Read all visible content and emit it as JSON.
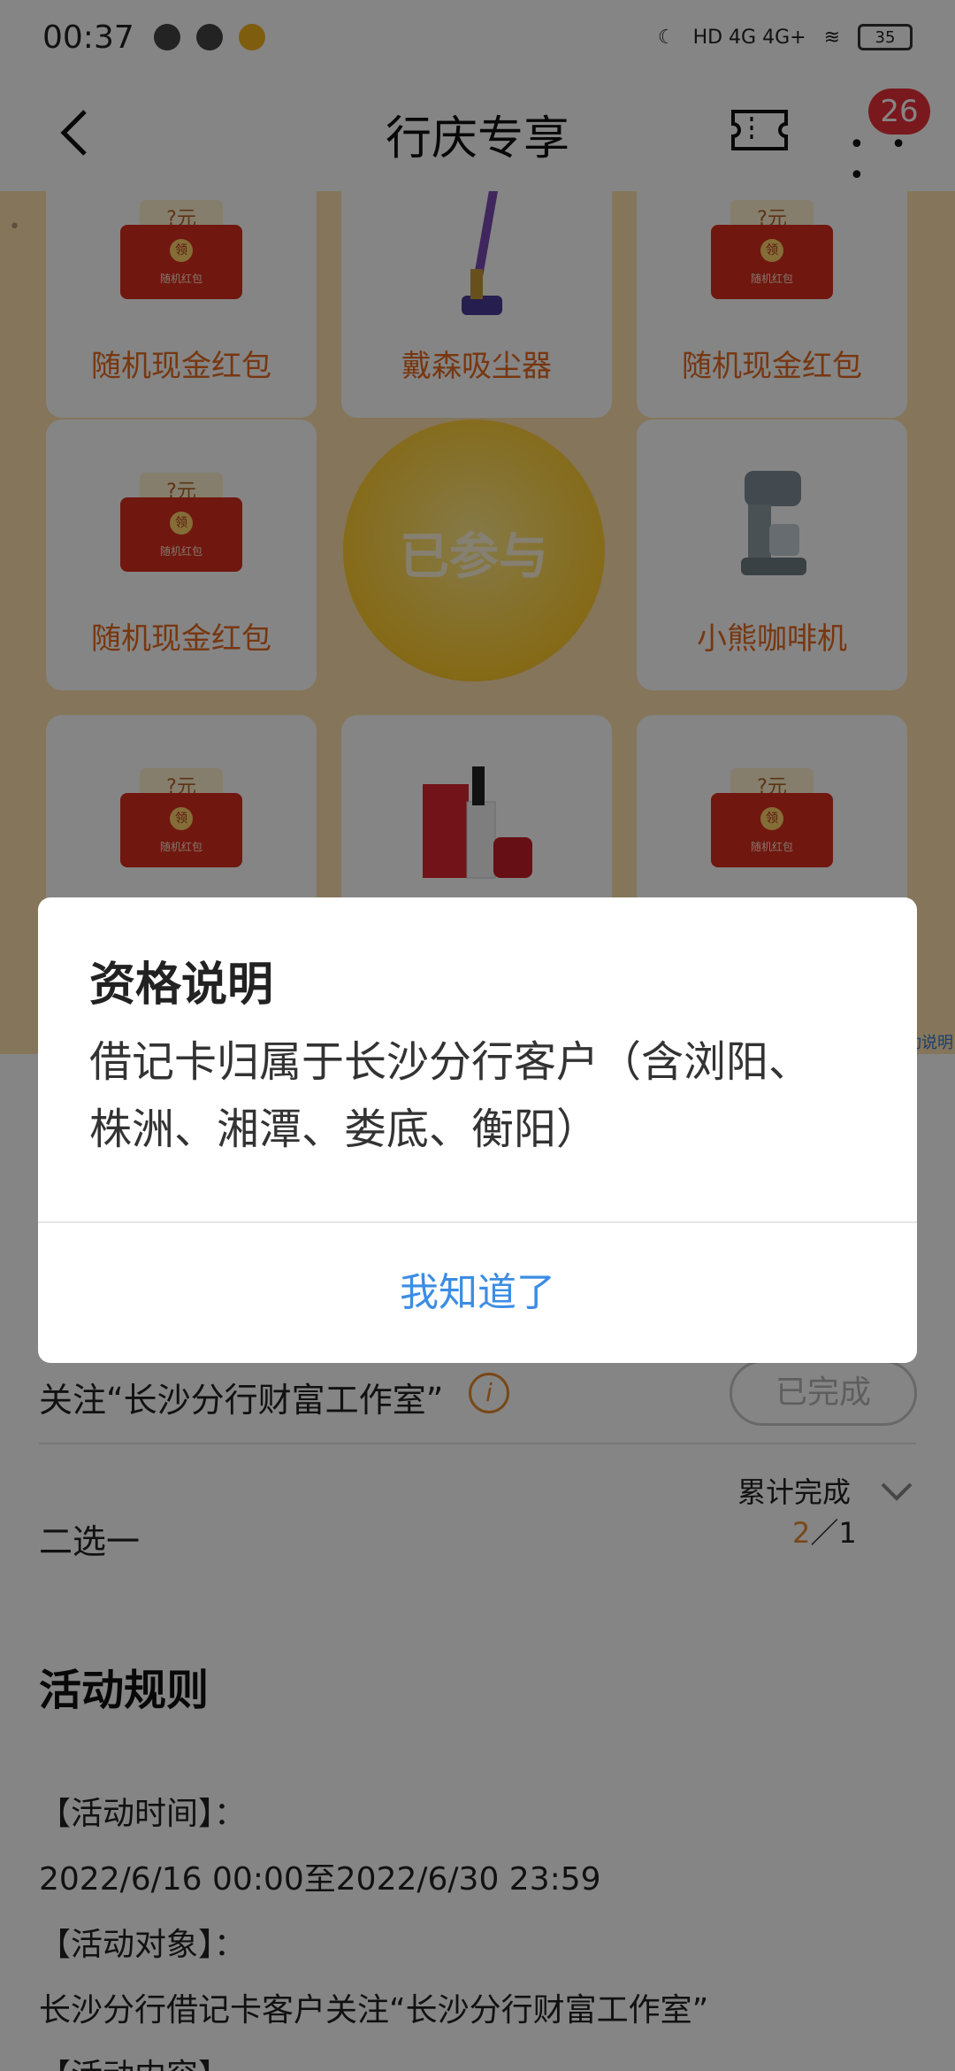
{
  "status_bar": {
    "time": "00:37",
    "network": "HD 4G 4G+",
    "battery": "35"
  },
  "nav": {
    "title": "行庆专享",
    "badge": "26"
  },
  "grid": {
    "cells": [
      {
        "label": "随机现金红包",
        "kind": "red-envelope"
      },
      {
        "label": "戴森吸尘器",
        "kind": "vacuum"
      },
      {
        "label": "随机现金红包",
        "kind": "red-envelope"
      },
      {
        "label": "随机现金红包",
        "kind": "red-envelope"
      },
      {
        "label": "小熊咖啡机",
        "kind": "coffee-maker"
      },
      {
        "label": "",
        "kind": "red-envelope"
      },
      {
        "label": "",
        "kind": "cosmetics"
      },
      {
        "label": "",
        "kind": "red-envelope"
      }
    ],
    "envelope_card_text": "?元",
    "envelope_seal_text": "领",
    "envelope_small_text": "随机红包",
    "center_button": "已参与",
    "side_link": "活动说明"
  },
  "tasks": {
    "follow": {
      "name": "关注“长沙分行财富工作室”",
      "button": "已完成"
    },
    "choose": {
      "name": "二选一",
      "cum_label": "累计完成",
      "cum_done": "2",
      "cum_sep": "／",
      "cum_total": "1"
    }
  },
  "rules": {
    "title": "活动规则",
    "time_label": "【活动时间】：",
    "time_value": "2022/6/16 00:00至2022/6/30 23:59",
    "target_label": "【活动对象】：",
    "target_value": "长沙分行借记卡客户关注“长沙分行财富工作室”",
    "content_label": "【活动内容】"
  },
  "dialog": {
    "title": "资格说明",
    "body": "借记卡归属于长沙分行客户（含浏阳、株洲、湘潭、娄底、衡阳）",
    "button": "我知道了"
  }
}
